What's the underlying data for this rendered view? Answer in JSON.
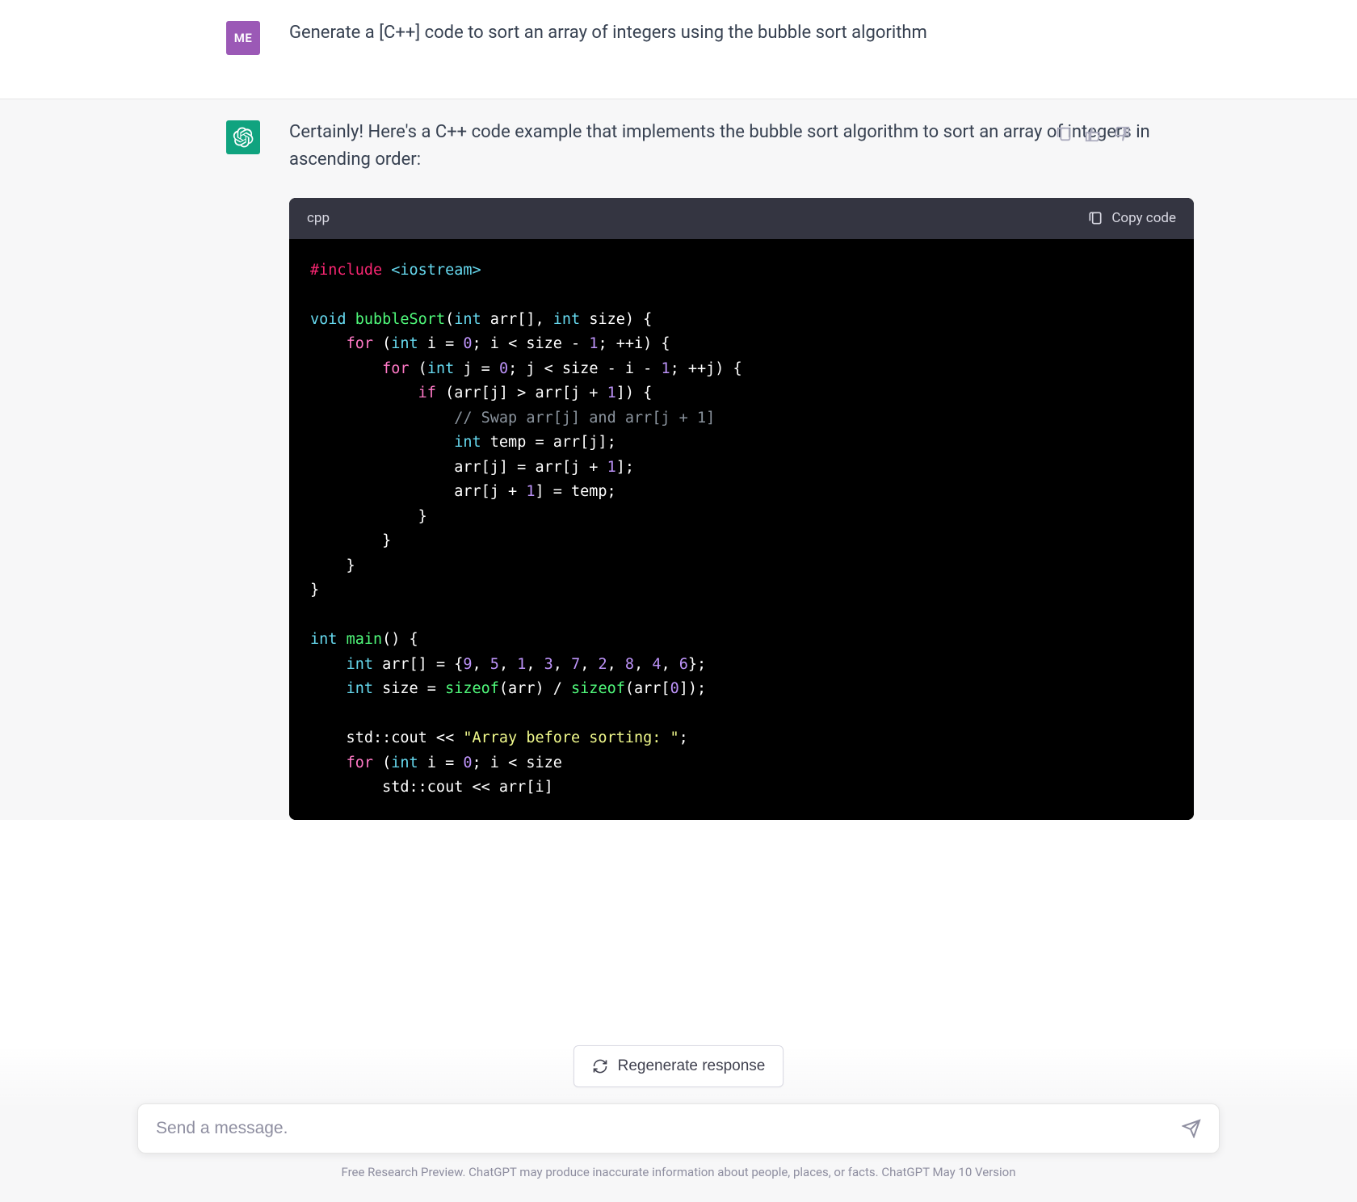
{
  "user": {
    "avatar_label": "ME",
    "message": "Generate a [C++] code to sort an array of integers using the bubble sort algorithm"
  },
  "assistant": {
    "intro": "Certainly! Here's a C++ code example that implements the bubble sort algorithm to sort an array of integers in ascending order:",
    "code_lang": "cpp",
    "copy_label": "Copy code",
    "code_tokens": [
      [
        [
          "preproc",
          "#include"
        ],
        [
          "op",
          " "
        ],
        [
          "include-path",
          "<iostream>"
        ]
      ],
      [],
      [
        [
          "type",
          "void"
        ],
        [
          "op",
          " "
        ],
        [
          "func",
          "bubbleSort"
        ],
        [
          "op",
          "("
        ],
        [
          "type",
          "int"
        ],
        [
          "op",
          " arr[], "
        ],
        [
          "type",
          "int"
        ],
        [
          "op",
          " size) {"
        ]
      ],
      [
        [
          "op",
          "    "
        ],
        [
          "keyword",
          "for"
        ],
        [
          "op",
          " ("
        ],
        [
          "type",
          "int"
        ],
        [
          "op",
          " i = "
        ],
        [
          "num",
          "0"
        ],
        [
          "op",
          "; i < size - "
        ],
        [
          "num",
          "1"
        ],
        [
          "op",
          "; ++i) {"
        ]
      ],
      [
        [
          "op",
          "        "
        ],
        [
          "keyword",
          "for"
        ],
        [
          "op",
          " ("
        ],
        [
          "type",
          "int"
        ],
        [
          "op",
          " j = "
        ],
        [
          "num",
          "0"
        ],
        [
          "op",
          "; j < size - i - "
        ],
        [
          "num",
          "1"
        ],
        [
          "op",
          "; ++j) {"
        ]
      ],
      [
        [
          "op",
          "            "
        ],
        [
          "keyword",
          "if"
        ],
        [
          "op",
          " (arr[j] > arr[j + "
        ],
        [
          "num",
          "1"
        ],
        [
          "op",
          "]) {"
        ]
      ],
      [
        [
          "op",
          "                "
        ],
        [
          "comment",
          "// Swap arr[j] and arr[j + 1]"
        ]
      ],
      [
        [
          "op",
          "                "
        ],
        [
          "type",
          "int"
        ],
        [
          "op",
          " temp = arr[j];"
        ]
      ],
      [
        [
          "op",
          "                arr[j] = arr[j + "
        ],
        [
          "num",
          "1"
        ],
        [
          "op",
          "];"
        ]
      ],
      [
        [
          "op",
          "                arr[j + "
        ],
        [
          "num",
          "1"
        ],
        [
          "op",
          "] = temp;"
        ]
      ],
      [
        [
          "op",
          "            }"
        ]
      ],
      [
        [
          "op",
          "        }"
        ]
      ],
      [
        [
          "op",
          "    }"
        ]
      ],
      [
        [
          "op",
          "}"
        ]
      ],
      [],
      [
        [
          "type",
          "int"
        ],
        [
          "op",
          " "
        ],
        [
          "func",
          "main"
        ],
        [
          "op",
          "() {"
        ]
      ],
      [
        [
          "op",
          "    "
        ],
        [
          "type",
          "int"
        ],
        [
          "op",
          " arr[] = {"
        ],
        [
          "num",
          "9"
        ],
        [
          "op",
          ", "
        ],
        [
          "num",
          "5"
        ],
        [
          "op",
          ", "
        ],
        [
          "num",
          "1"
        ],
        [
          "op",
          ", "
        ],
        [
          "num",
          "3"
        ],
        [
          "op",
          ", "
        ],
        [
          "num",
          "7"
        ],
        [
          "op",
          ", "
        ],
        [
          "num",
          "2"
        ],
        [
          "op",
          ", "
        ],
        [
          "num",
          "8"
        ],
        [
          "op",
          ", "
        ],
        [
          "num",
          "4"
        ],
        [
          "op",
          ", "
        ],
        [
          "num",
          "6"
        ],
        [
          "op",
          "};"
        ]
      ],
      [
        [
          "op",
          "    "
        ],
        [
          "type",
          "int"
        ],
        [
          "op",
          " size = "
        ],
        [
          "func",
          "sizeof"
        ],
        [
          "op",
          "(arr) / "
        ],
        [
          "func",
          "sizeof"
        ],
        [
          "op",
          "(arr["
        ],
        [
          "num",
          "0"
        ],
        [
          "op",
          "]);"
        ]
      ],
      [],
      [
        [
          "op",
          "    std::cout << "
        ],
        [
          "string",
          "\"Array before sorting: \""
        ],
        [
          "op",
          ";"
        ]
      ],
      [
        [
          "op",
          "    "
        ],
        [
          "keyword",
          "for"
        ],
        [
          "op",
          " ("
        ],
        [
          "type",
          "int"
        ],
        [
          "op",
          " i = "
        ],
        [
          "num",
          "0"
        ],
        [
          "op",
          "; i < size"
        ]
      ],
      [
        [
          "op",
          "        std::cout << arr[i]"
        ]
      ]
    ]
  },
  "controls": {
    "regenerate_label": "Regenerate response",
    "input_placeholder": "Send a message.",
    "footer": "Free Research Preview. ChatGPT may produce inaccurate information about people, places, or facts. ChatGPT May 10 Version"
  }
}
